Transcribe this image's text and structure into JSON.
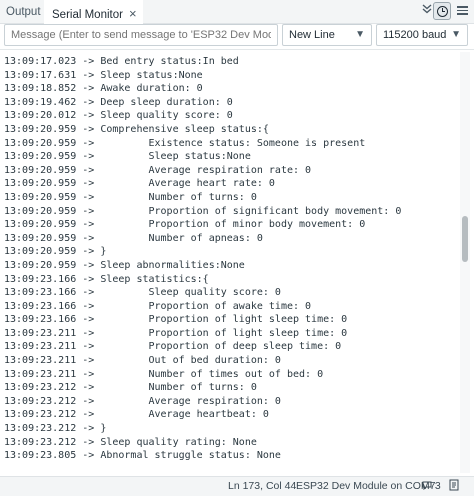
{
  "tabs": {
    "output_label": "Output",
    "serial_label": "Serial Monitor",
    "serial_close": "×"
  },
  "toolbar_icons": {
    "collapse": "chevron-double-down-icon",
    "timestamp": "clock-icon",
    "more": "menu-icon"
  },
  "message": {
    "placeholder": "Message (Enter to send message to 'ESP32 Dev Module' on..."
  },
  "line_ending": {
    "value": "New Line"
  },
  "baud_rate": {
    "value": "115200 baud"
  },
  "console_lines": [
    "13:09:17.023 -> Bed entry status:In bed",
    "13:09:17.631 -> Sleep status:None",
    "13:09:18.852 -> Awake duration: 0",
    "13:09:19.462 -> Deep sleep duration: 0",
    "13:09:20.012 -> Sleep quality score: 0",
    "13:09:20.959 -> Comprehensive sleep status:{",
    "13:09:20.959 ->         Existence status: Someone is present",
    "13:09:20.959 ->         Sleep status:None",
    "13:09:20.959 ->         Average respiration rate: 0",
    "13:09:20.959 ->         Average heart rate: 0",
    "13:09:20.959 ->         Number of turns: 0",
    "13:09:20.959 ->         Proportion of significant body movement: 0",
    "13:09:20.959 ->         Proportion of minor body movement: 0",
    "13:09:20.959 ->         Number of apneas: 0",
    "13:09:20.959 -> }",
    "13:09:20.959 -> Sleep abnormalities:None",
    "13:09:23.166 -> Sleep statistics:{",
    "13:09:23.166 ->         Sleep quality score: 0",
    "13:09:23.166 ->         Proportion of awake time: 0",
    "13:09:23.166 ->         Proportion of light sleep time: 0",
    "13:09:23.211 ->         Proportion of light sleep time: 0",
    "13:09:23.211 ->         Proportion of deep sleep time: 0",
    "13:09:23.211 ->         Out of bed duration: 0",
    "13:09:23.211 ->         Number of times out of bed: 0",
    "13:09:23.212 ->         Number of turns: 0",
    "13:09:23.212 ->         Average respiration: 0",
    "13:09:23.212 ->         Average heartbeat: 0",
    "13:09:23.212 -> }",
    "13:09:23.212 -> Sleep quality rating: None",
    "13:09:23.805 -> Abnormal struggle status: None"
  ],
  "status": {
    "position": "Ln 173, Col 44",
    "board": "ESP32 Dev Module on COM7",
    "notifications": "3"
  }
}
